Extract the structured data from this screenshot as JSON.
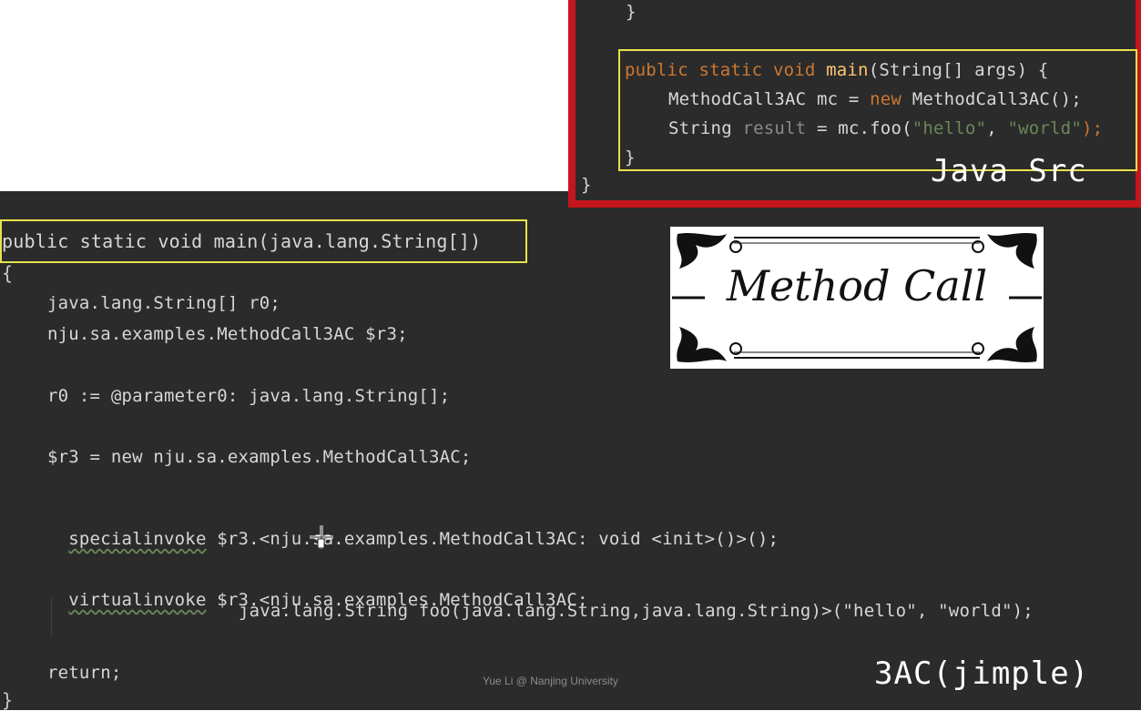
{
  "java_src": {
    "line_close_brace_top": "}",
    "line_main_sig_kw": "public static void ",
    "line_main_sig_fn": "main",
    "line_main_sig_rest": "(String[] args) {",
    "line_mc_type": "MethodCall3AC mc = ",
    "line_mc_new": "new",
    "line_mc_ctor": " MethodCall3AC();",
    "line_res_type": "String ",
    "line_res_var": "result",
    "line_res_call": " = mc.foo(",
    "line_res_arg1": "\"hello\"",
    "line_res_comma": ", ",
    "line_res_arg2": "\"world\"",
    "line_res_end": ");",
    "line_inner_close": "}",
    "line_outer_close": "}",
    "label": "Java Src"
  },
  "jimple": {
    "signature": "public static void main(java.lang.String[])",
    "open_brace": "{",
    "decl1": "java.lang.String[] r0;",
    "decl2": "nju.sa.examples.MethodCall3AC $r3;",
    "param": "r0 := @parameter0: java.lang.String[];",
    "new_stmt": "$r3 = new nju.sa.examples.MethodCall3AC;",
    "special_kw": "specialinvoke",
    "special_rest": " $r3.<nju.sa.examples.MethodCall3AC: void <init>()>();",
    "virtual_kw": "virtualinvoke",
    "virtual_rest": " $r3.<nju.sa.examples.MethodCall3AC:",
    "virtual_cont": "java.lang.String foo(java.lang.String,java.lang.String)>(\"hello\", \"world\");",
    "return_stmt": "return;",
    "close_brace": "}",
    "label": "3AC(jimple)"
  },
  "title_card": {
    "text": "Method Call"
  },
  "watermark": "Yue Li @ Nanjing University",
  "colors": {
    "editor_bg": "#2b2b2b",
    "keyword": "#cc7832",
    "function": "#ffc66d",
    "string": "#6a8759",
    "highlight_box": "#e8e24a",
    "frame_red": "#c4161c"
  }
}
